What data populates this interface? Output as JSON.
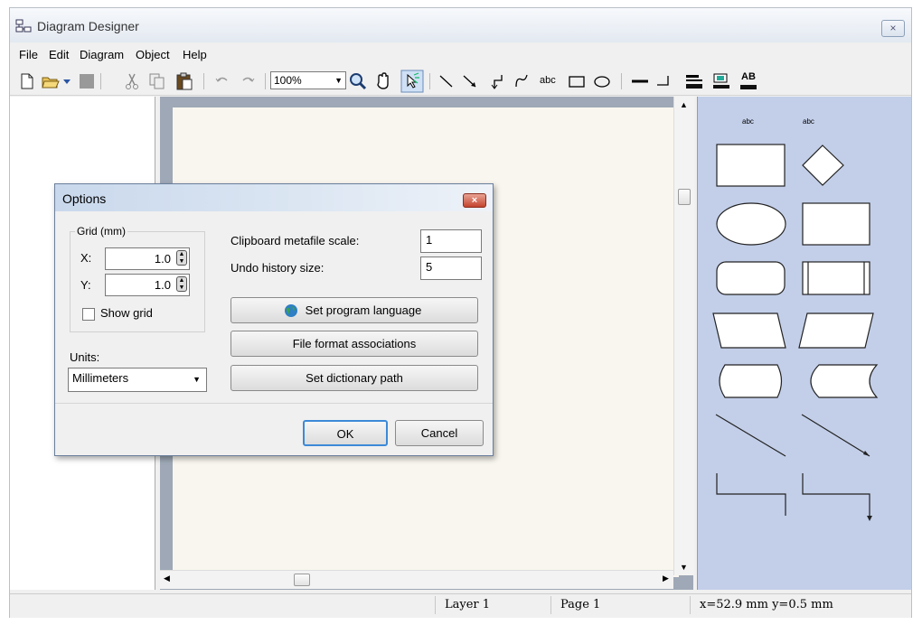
{
  "window": {
    "title": "Diagram Designer",
    "close_label": "×"
  },
  "menu": [
    "File",
    "Edit",
    "Diagram",
    "Object",
    "Help"
  ],
  "toolbar": {
    "zoom": "100%",
    "text_tool": "abc",
    "font_tool": "AB"
  },
  "shapes": {
    "text_a": "abc",
    "text_b": "abc"
  },
  "statusbar": {
    "layer": "Layer 1",
    "page": "Page 1",
    "coords": "x=52.9 mm  y=0.5 mm"
  },
  "dialog": {
    "title": "Options",
    "close_label": "×",
    "grid_legend": "Grid (mm)",
    "x_label": "X:",
    "x_value": "1.0",
    "y_label": "Y:",
    "y_value": "1.0",
    "show_grid_label": "Show grid",
    "show_grid_checked": false,
    "units_label": "Units:",
    "units_value": "Millimeters",
    "clipboard_label": "Clipboard metafile scale:",
    "clipboard_value": "1",
    "undo_label": "Undo history size:",
    "undo_value": "5",
    "set_language": "Set program language",
    "file_assoc": "File format associations",
    "dict_path": "Set dictionary path",
    "ok": "OK",
    "cancel": "Cancel"
  }
}
